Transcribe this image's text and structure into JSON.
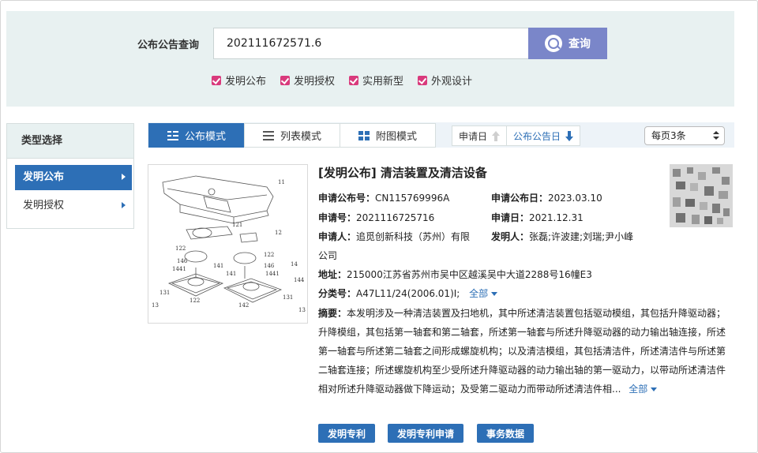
{
  "search": {
    "label": "公布公告查询",
    "query": "202111672571.6",
    "button_label": "查询",
    "filters": [
      {
        "label": "发明公布",
        "checked": true
      },
      {
        "label": "发明授权",
        "checked": true
      },
      {
        "label": "实用新型",
        "checked": true
      },
      {
        "label": "外观设计",
        "checked": true
      }
    ]
  },
  "sidebar": {
    "title": "类型选择",
    "items": [
      {
        "label": "发明公布",
        "active": true
      },
      {
        "label": "发明授权",
        "active": false
      }
    ]
  },
  "toolbar": {
    "tabs": [
      {
        "label": "公布模式",
        "active": true,
        "icon": "list-lines-icon"
      },
      {
        "label": "列表模式",
        "active": false,
        "icon": "list-icon"
      },
      {
        "label": "附图模式",
        "active": false,
        "icon": "grid-icon"
      }
    ],
    "sorts": [
      {
        "label": "申请日",
        "direction": "up",
        "active": false
      },
      {
        "label": "公布公告日",
        "direction": "down",
        "active": true
      }
    ],
    "per_page": "每页3条"
  },
  "result": {
    "title": "[发明公布] 清洁装置及清洁设备",
    "pub_no_label": "申请公布号：",
    "pub_no": "CN115769996A",
    "pub_date_label": "申请公布日：",
    "pub_date": "2023.03.10",
    "app_no_label": "申请号：",
    "app_no": "2021116725716",
    "app_date_label": "申请日：",
    "app_date": "2021.12.31",
    "applicant_label": "申请人：",
    "applicant_line1": "追觅创新科技（苏州）有限",
    "applicant_line2": "公司",
    "inventor_label": "发明人：",
    "inventor": "张磊;许波建;刘瑞;尹小峰",
    "address_label": "地址：",
    "address": "215000江苏省苏州市吴中区越溪吴中大道2288号16幢E3",
    "class_label": "分类号：",
    "class_no": "A47L11/24(2006.01)I;",
    "expand_label": "全部",
    "abstract_label": "摘要：",
    "abstract": "本发明涉及一种清洁装置及扫地机，其中所述清洁装置包括驱动模组，其包括升降驱动器；升降模组，其包括第一轴套和第二轴套，所述第一轴套与所述升降驱动器的动力输出轴连接，所述第一轴套与所述第二轴套之间形成螺旋机构；以及清洁模组，其包括清洁件，所述清洁件与所述第二轴套连接；所述螺旋机构至少受所述升降驱动器的动力输出轴的第一驱动力，以带动所述清洁件相对所述升降驱动器做下降运动；及受第二驱动力而带动所述清洁件相...",
    "abstract_expand": "全部",
    "drawing_labels": [
      "11",
      "121",
      "12",
      "122",
      "122",
      "146",
      "146",
      "14",
      "1441",
      "141",
      "141",
      "1441",
      "144",
      "131",
      "122",
      "142",
      "131",
      "13",
      "13"
    ]
  },
  "actions": [
    "发明专利",
    "发明专利申请",
    "事务数据"
  ],
  "colors": {
    "accent": "#2d6fb6",
    "search_button": "#7a86c9",
    "checkbox": "#d93a7c",
    "panel": "#e8f1f1"
  }
}
